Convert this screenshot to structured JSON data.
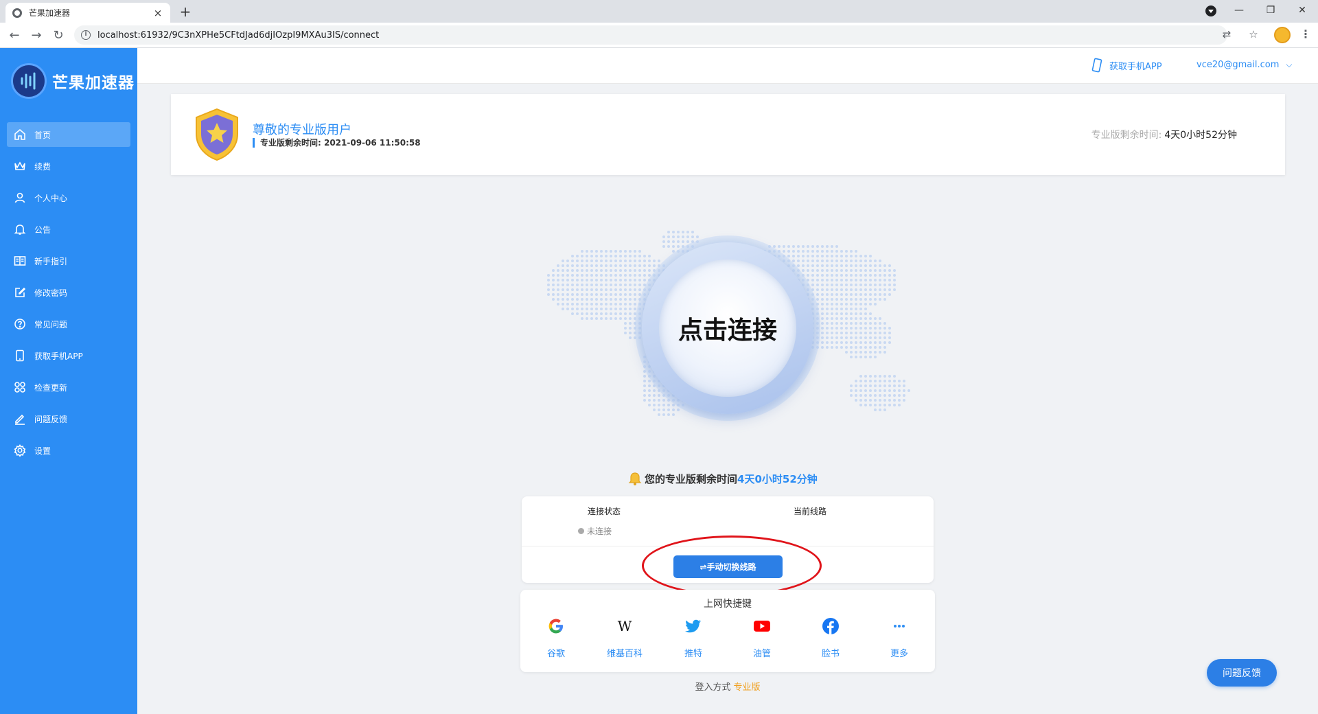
{
  "browser": {
    "tab_title": "芒果加速器",
    "tab_close": "×",
    "new_tab": "+",
    "url": "localhost:61932/9C3nXPHe5CFtdJad6djIOzpI9MXAu3IS/connect",
    "win_minimize": "—",
    "win_restore": "❐",
    "win_close": "✕"
  },
  "app": {
    "name": "芒果加速器"
  },
  "sidebar": {
    "items": [
      {
        "label": "首页",
        "icon": "home-icon"
      },
      {
        "label": "续费",
        "icon": "crown-icon"
      },
      {
        "label": "个人中心",
        "icon": "user-icon"
      },
      {
        "label": "公告",
        "icon": "bell-icon"
      },
      {
        "label": "新手指引",
        "icon": "book-icon"
      },
      {
        "label": "修改密码",
        "icon": "edit-icon"
      },
      {
        "label": "常见问题",
        "icon": "question-icon"
      },
      {
        "label": "获取手机APP",
        "icon": "phone-icon"
      },
      {
        "label": "检查更新",
        "icon": "apps-icon"
      },
      {
        "label": "问题反馈",
        "icon": "feedback-icon"
      },
      {
        "label": "设置",
        "icon": "settings-icon"
      }
    ]
  },
  "header": {
    "get_app": "获取手机APP",
    "user_email": "vce20@gmail.com"
  },
  "pro_card": {
    "title": "尊敬的专业版用户",
    "expire_text": "专业版剩余时间: 2021-09-06 11:50:58",
    "remaining_label": "专业版剩余时间:",
    "remaining_value": "4天0小时52分钟"
  },
  "connect": {
    "button_label": "点击连接"
  },
  "notice": {
    "prefix": "您的专业版剩余时间",
    "time": "4天0小时52分钟"
  },
  "status": {
    "state_label": "连接状态",
    "line_label": "当前线路",
    "state_value": "未连接",
    "switch_button": "⇌手动切换线路"
  },
  "shortcuts": {
    "title": "上网快捷键",
    "items": [
      {
        "label": "谷歌",
        "icon": "google-icon"
      },
      {
        "label": "维基百科",
        "icon": "wikipedia-icon"
      },
      {
        "label": "推特",
        "icon": "twitter-icon"
      },
      {
        "label": "油管",
        "icon": "youtube-icon"
      },
      {
        "label": "脸书",
        "icon": "facebook-icon"
      },
      {
        "label": "更多",
        "icon": "more-icon"
      }
    ]
  },
  "login": {
    "label": "登入方式",
    "mode": "专业版"
  },
  "feedback_button": "问题反馈",
  "colors": {
    "primary": "#2c8df4",
    "sidebar": "#2c8df4",
    "accent_orange": "#f0a020",
    "annotation_red": "#e0141a"
  }
}
